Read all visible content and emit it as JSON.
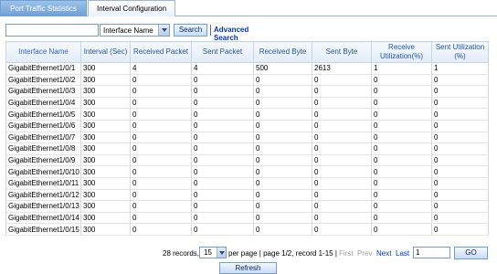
{
  "tabs": [
    {
      "label": "Port Traffic Statistics"
    },
    {
      "label": "Interval Configuration"
    }
  ],
  "search": {
    "value": "",
    "placeholder": "",
    "field_selected": "Interface Name",
    "search_label": "Search",
    "advanced_label": "Advanced Search"
  },
  "table": {
    "columns": [
      "Interface Name",
      "Interval (Sec)",
      "Received Packet",
      "Sent Packet",
      "Received Byte",
      "Sent Byte",
      "Receive Utilization(%)",
      "Sent Utilization (%)"
    ],
    "rows": [
      [
        "GigabitEthernet1/0/1",
        "300",
        "4",
        "4",
        "500",
        "2613",
        "1",
        "1"
      ],
      [
        "GigabitEthernet1/0/2",
        "300",
        "0",
        "0",
        "0",
        "0",
        "0",
        "0"
      ],
      [
        "GigabitEthernet1/0/3",
        "300",
        "0",
        "0",
        "0",
        "0",
        "0",
        "0"
      ],
      [
        "GigabitEthernet1/0/4",
        "300",
        "0",
        "0",
        "0",
        "0",
        "0",
        "0"
      ],
      [
        "GigabitEthernet1/0/5",
        "300",
        "0",
        "0",
        "0",
        "0",
        "0",
        "0"
      ],
      [
        "GigabitEthernet1/0/6",
        "300",
        "0",
        "0",
        "0",
        "0",
        "0",
        "0"
      ],
      [
        "GigabitEthernet1/0/7",
        "300",
        "0",
        "0",
        "0",
        "0",
        "0",
        "0"
      ],
      [
        "GigabitEthernet1/0/8",
        "300",
        "0",
        "0",
        "0",
        "0",
        "0",
        "0"
      ],
      [
        "GigabitEthernet1/0/9",
        "300",
        "0",
        "0",
        "0",
        "0",
        "0",
        "0"
      ],
      [
        "GigabitEthernet1/0/10",
        "300",
        "0",
        "0",
        "0",
        "0",
        "0",
        "0"
      ],
      [
        "GigabitEthernet1/0/11",
        "300",
        "0",
        "0",
        "0",
        "0",
        "0",
        "0"
      ],
      [
        "GigabitEthernet1/0/12",
        "300",
        "0",
        "0",
        "0",
        "0",
        "0",
        "0"
      ],
      [
        "GigabitEthernet1/0/13",
        "300",
        "0",
        "0",
        "0",
        "0",
        "0",
        "0"
      ],
      [
        "GigabitEthernet1/0/14",
        "300",
        "0",
        "0",
        "0",
        "0",
        "0",
        "0"
      ],
      [
        "GigabitEthernet1/0/15",
        "300",
        "0",
        "0",
        "0",
        "0",
        "0",
        "0"
      ]
    ]
  },
  "pager": {
    "records_text": "28 records,",
    "per_page_value": "15",
    "info_text": "per page | page 1/2, record 1-15 |",
    "first_label": "First",
    "prev_label": "Prev",
    "next_label": "Next",
    "last_label": "Last",
    "page_input_value": "1",
    "go_label": "GO",
    "refresh_label": "Refresh"
  },
  "colors": {
    "tab_active": "#6f9fd4",
    "header_text": "#2355a5",
    "link": "#0033cc"
  }
}
